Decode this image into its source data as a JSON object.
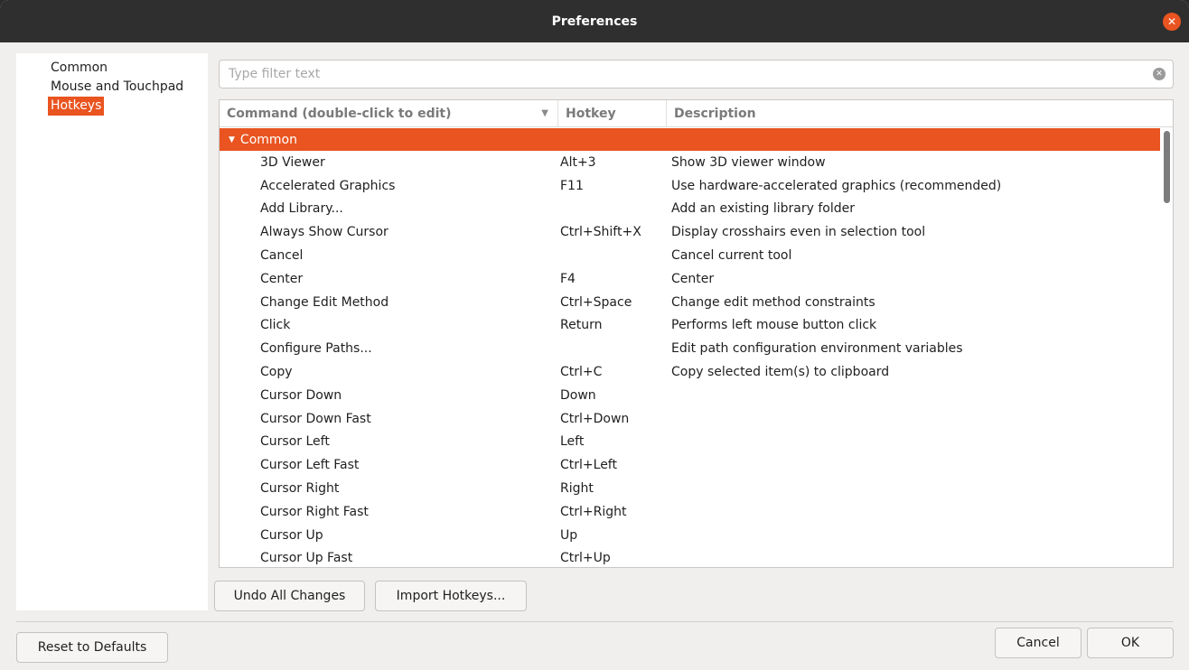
{
  "window": {
    "title": "Preferences"
  },
  "sidebar": {
    "items": [
      {
        "label": "Common",
        "selected": false
      },
      {
        "label": "Mouse and Touchpad",
        "selected": false
      },
      {
        "label": "Hotkeys",
        "selected": true
      }
    ]
  },
  "filter": {
    "placeholder": "Type filter text",
    "value": ""
  },
  "table": {
    "columns": [
      "Command (double-click to edit)",
      "Hotkey",
      "Description"
    ],
    "group": "Common",
    "rows": [
      {
        "command": "3D Viewer",
        "hotkey": "Alt+3",
        "description": "Show 3D viewer window"
      },
      {
        "command": "Accelerated Graphics",
        "hotkey": "F11",
        "description": "Use hardware-accelerated graphics (recommended)"
      },
      {
        "command": "Add Library...",
        "hotkey": "",
        "description": "Add an existing library folder"
      },
      {
        "command": "Always Show Cursor",
        "hotkey": "Ctrl+Shift+X",
        "description": "Display crosshairs even in selection tool"
      },
      {
        "command": "Cancel",
        "hotkey": "",
        "description": "Cancel current tool"
      },
      {
        "command": "Center",
        "hotkey": "F4",
        "description": "Center"
      },
      {
        "command": "Change Edit Method",
        "hotkey": "Ctrl+Space",
        "description": "Change edit method constraints"
      },
      {
        "command": "Click",
        "hotkey": "Return",
        "description": "Performs left mouse button click"
      },
      {
        "command": "Configure Paths...",
        "hotkey": "",
        "description": "Edit path configuration environment variables"
      },
      {
        "command": "Copy",
        "hotkey": "Ctrl+C",
        "description": "Copy selected item(s) to clipboard"
      },
      {
        "command": "Cursor Down",
        "hotkey": "Down",
        "description": ""
      },
      {
        "command": "Cursor Down Fast",
        "hotkey": "Ctrl+Down",
        "description": ""
      },
      {
        "command": "Cursor Left",
        "hotkey": "Left",
        "description": ""
      },
      {
        "command": "Cursor Left Fast",
        "hotkey": "Ctrl+Left",
        "description": ""
      },
      {
        "command": "Cursor Right",
        "hotkey": "Right",
        "description": ""
      },
      {
        "command": "Cursor Right Fast",
        "hotkey": "Ctrl+Right",
        "description": ""
      },
      {
        "command": "Cursor Up",
        "hotkey": "Up",
        "description": ""
      },
      {
        "command": "Cursor Up Fast",
        "hotkey": "Ctrl+Up",
        "description": ""
      }
    ]
  },
  "buttons": {
    "undo_all": "Undo All Changes",
    "import": "Import Hotkeys...",
    "reset": "Reset to Defaults",
    "cancel": "Cancel",
    "ok": "OK"
  },
  "colors": {
    "accent": "#e95420",
    "titlebar": "#2f2f2f"
  },
  "icons": {
    "close": "close-icon",
    "clear": "clear-filter-icon",
    "expand": "triangle-down-icon",
    "sort": "sort-down-icon"
  }
}
